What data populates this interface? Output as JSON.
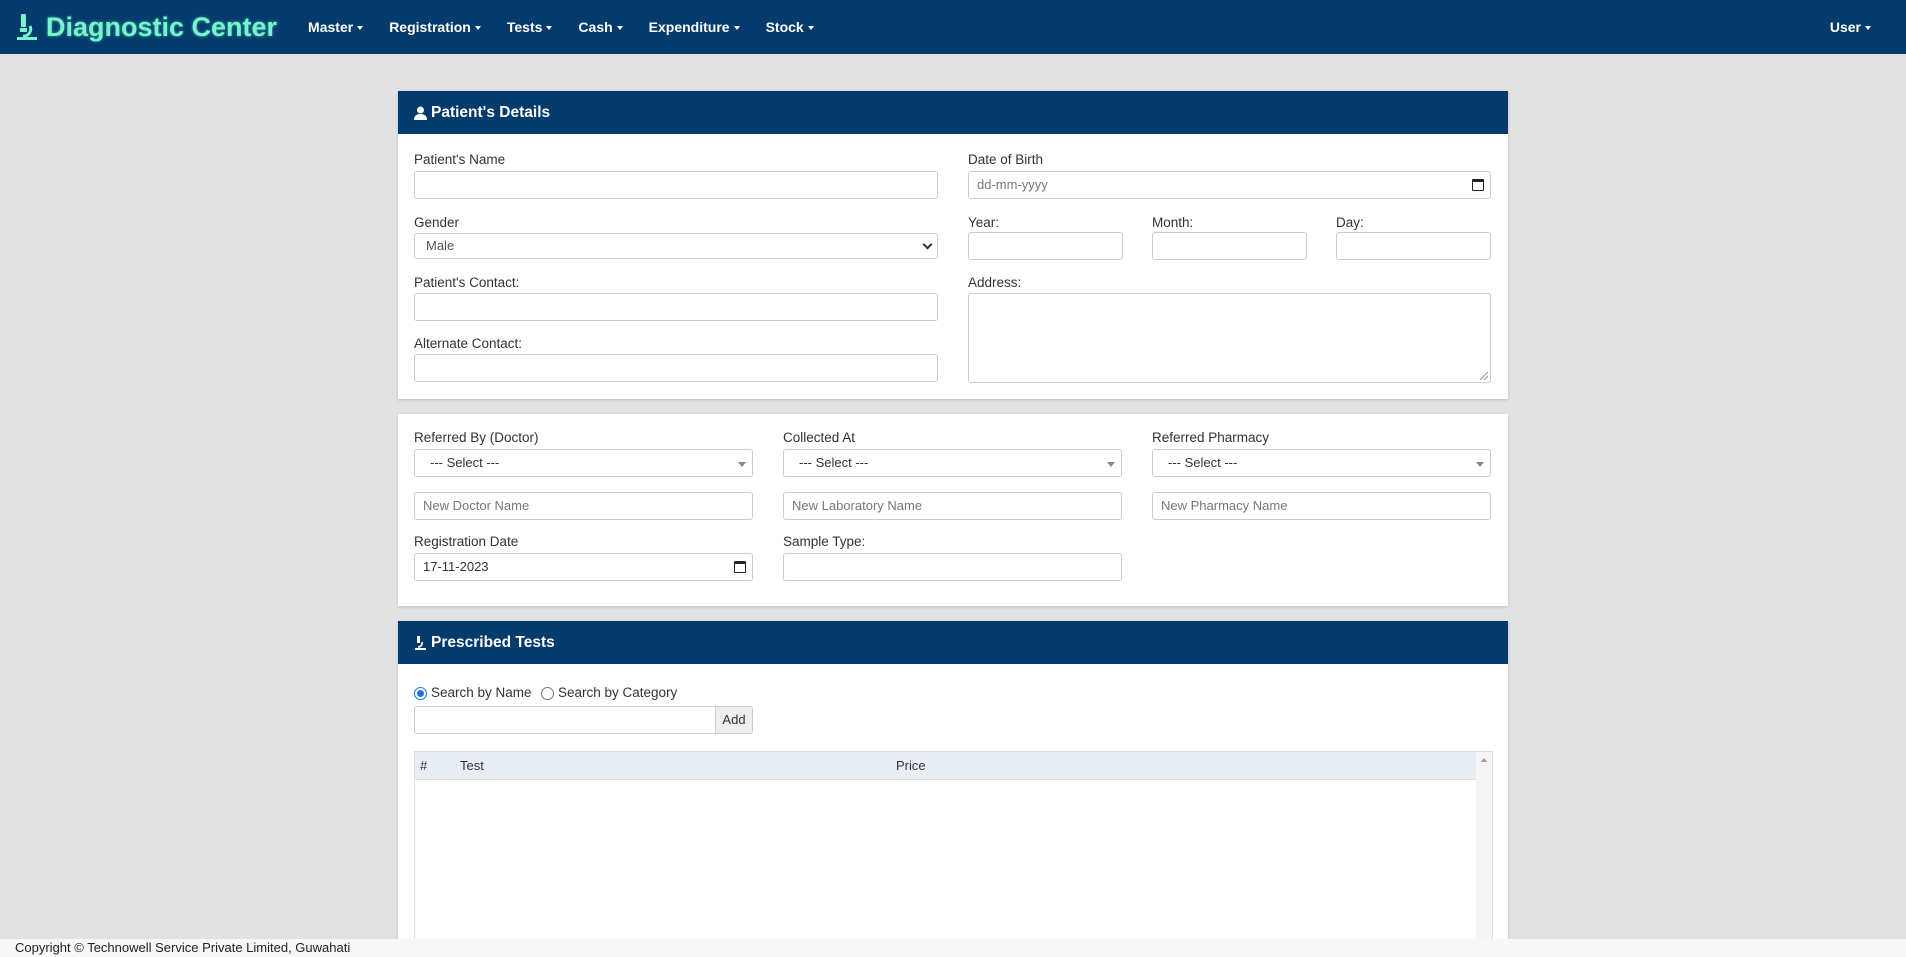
{
  "navbar": {
    "brand": "Diagnostic Center",
    "menu": [
      "Master",
      "Registration",
      "Tests",
      "Cash",
      "Expenditure",
      "Stock"
    ],
    "user": "User",
    "colors": {
      "background": "#053a6d",
      "brand": "#7af1cf"
    }
  },
  "patient_details": {
    "title": "Patient's Details",
    "name_label": "Patient's Name",
    "name_value": "",
    "dob_label": "Date of Birth",
    "dob_placeholder": "dd-mm-yyyy",
    "gender_label": "Gender",
    "gender_value": "Male",
    "year_label": "Year:",
    "month_label": "Month:",
    "day_label": "Day:",
    "contact_label": "Patient's Contact:",
    "address_label": "Address:",
    "alt_contact_label": "Alternate Contact:"
  },
  "referral": {
    "doctor_label": "Referred By (Doctor)",
    "doctor_select": "--- Select ---",
    "doctor_placeholder": "New Doctor Name",
    "collected_label": "Collected At",
    "collected_select": "--- Select ---",
    "lab_placeholder": "New Laboratory Name",
    "pharmacy_label": "Referred Pharmacy",
    "pharmacy_select": "--- Select ---",
    "pharmacy_placeholder": "New Pharmacy Name",
    "reg_date_label": "Registration Date",
    "reg_date_value": "17-11-2023",
    "sample_type_label": "Sample Type:"
  },
  "tests": {
    "title": "Prescribed Tests",
    "radio_name": "Search by Name",
    "radio_category": "Search by Category",
    "add_button": "Add",
    "columns": [
      "#",
      "Test",
      "Price"
    ]
  },
  "footer": {
    "copyright": "Copyright © Technowell Service Private Limited, Guwahati"
  }
}
